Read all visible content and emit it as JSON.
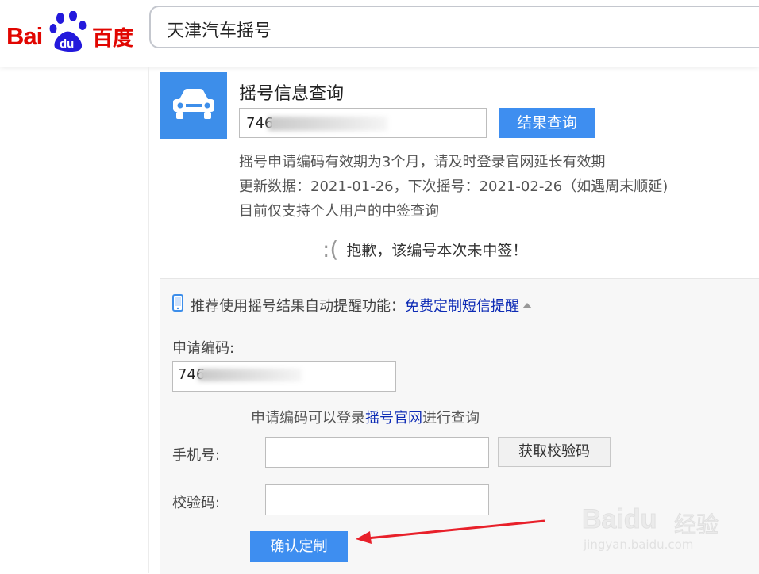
{
  "header": {
    "logo_text_left": "Bai",
    "logo_text_right": "百度",
    "logo_paw_text": "du",
    "search_query": "天津汽车摇号"
  },
  "card": {
    "icon": "car-icon",
    "title": "摇号信息查询",
    "code_prefix": "746",
    "query_button": "结果查询",
    "info_lines": [
      "摇号申请编码有效期为3个月，请及时登录官网延长有效期",
      "更新数据：2021-01-26，下次摇号：2021-02-26（如遇周末顺延)",
      "目前仅支持个人用户的中签查询"
    ],
    "sorry_face": ":(",
    "sorry_text": "抱歉，该编号本次未中签！"
  },
  "subscribe": {
    "icon": "mobile-phone-icon",
    "recommend_text": "推荐使用摇号结果自动提醒功能：",
    "sms_link": "免费定制短信提醒",
    "code_label": "申请编码:",
    "code_prefix": "746",
    "hint_prefix": "申请编码可以登录",
    "hint_link": "摇号官网",
    "hint_suffix": "进行查询",
    "phone_label": "手机号:",
    "get_code_button": "获取校验码",
    "verify_label": "校验码:",
    "confirm_button": "确认定制"
  },
  "watermark": {
    "line1": "Baidu",
    "line2": "经验",
    "line3": "jingyan.baidu.com"
  },
  "colors": {
    "brand_red": "#e10601",
    "button_blue": "#3e8ef0",
    "link_blue": "#0d2bb5",
    "arrow_red": "#e8202a"
  }
}
